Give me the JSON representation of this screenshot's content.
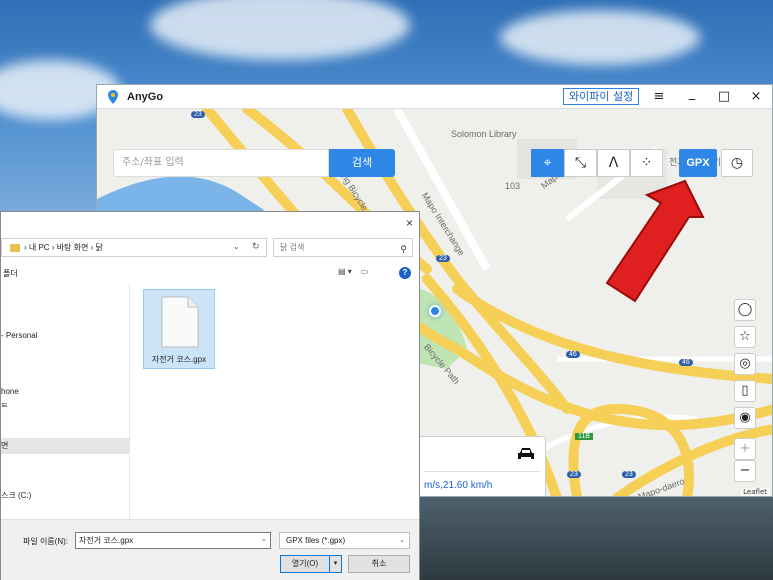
{
  "app": {
    "title": "AnyGo",
    "wifi_label": "와이파이 설정",
    "menu_icon": "≡",
    "minimize_icon": "_",
    "maximize_icon": "□",
    "close_icon": "×"
  },
  "search": {
    "placeholder": "주소/좌표 입력",
    "button_label": "검색"
  },
  "modes": {
    "teleport_icon": "⌖",
    "two_spot_icon": "⤡",
    "multi_spot_icon": "ᐱ",
    "joystick_icon": "⁘",
    "gpx_label": "GPX",
    "history_icon": "◷"
  },
  "map": {
    "labels": {
      "library": "Solomon Library",
      "mapo_daero": "Mapo-daero",
      "mapo_interchange": "Mapo Interchange",
      "charging": "전기차 충전기",
      "building_num": "103",
      "bicycle_path": "Hangang Bicycle Path",
      "bicycle_path2": "Bicycle Path",
      "mapo_daero2": "Mapo-daero",
      "route_23a": "23",
      "route_23b": "23",
      "route_23c": "23",
      "route_23d": "23",
      "route_46a": "46",
      "route_46b": "46",
      "route_11b": "11B"
    },
    "leaflet": "Leaflet",
    "speed_text": "m/s,21.60 km/h",
    "car_icon": "car-icon",
    "side_buttons": [
      "◯",
      "☆",
      "◎",
      "▯",
      "◉",
      "+",
      "−"
    ]
  },
  "dialog": {
    "close_icon": "×",
    "breadcrumb": "›  내 PC  ›  바탕 화면  ›  닭",
    "search_placeholder": "닭 검색",
    "new_folder": "폴더",
    "nav_items": [
      "- Personal",
      "hone",
      "ㅌ",
      "면",
      "스크 (C:)"
    ],
    "file_name": "자전거 코스.gpx",
    "filename_label": "파일 이름(N):",
    "filename_value": "자전거 코스.gpx",
    "filetype_value": "GPX files (*.gpx)",
    "open_label": "열기(O)",
    "cancel_label": "취소"
  },
  "colors": {
    "accent": "#2e86e6",
    "road": "#f5cf56",
    "arrow": "#e02020"
  }
}
